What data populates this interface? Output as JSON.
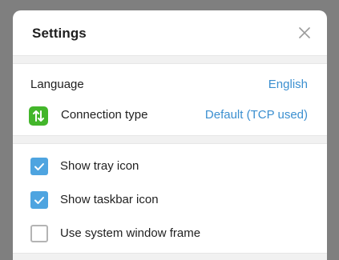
{
  "dialog": {
    "title": "Settings",
    "close_icon": "close-icon"
  },
  "general": {
    "language_label": "Language",
    "language_value": "English",
    "connection_icon": "connection-arrows-icon",
    "connection_icon_color": "#43b62b",
    "connection_label": "Connection type",
    "connection_value": "Default (TCP used)"
  },
  "options": [
    {
      "label": "Show tray icon",
      "checked": true
    },
    {
      "label": "Show taskbar icon",
      "checked": true
    },
    {
      "label": "Use system window frame",
      "checked": false
    }
  ],
  "colors": {
    "accent": "#3b8fd0",
    "checkbox_on": "#4ea4e0"
  }
}
